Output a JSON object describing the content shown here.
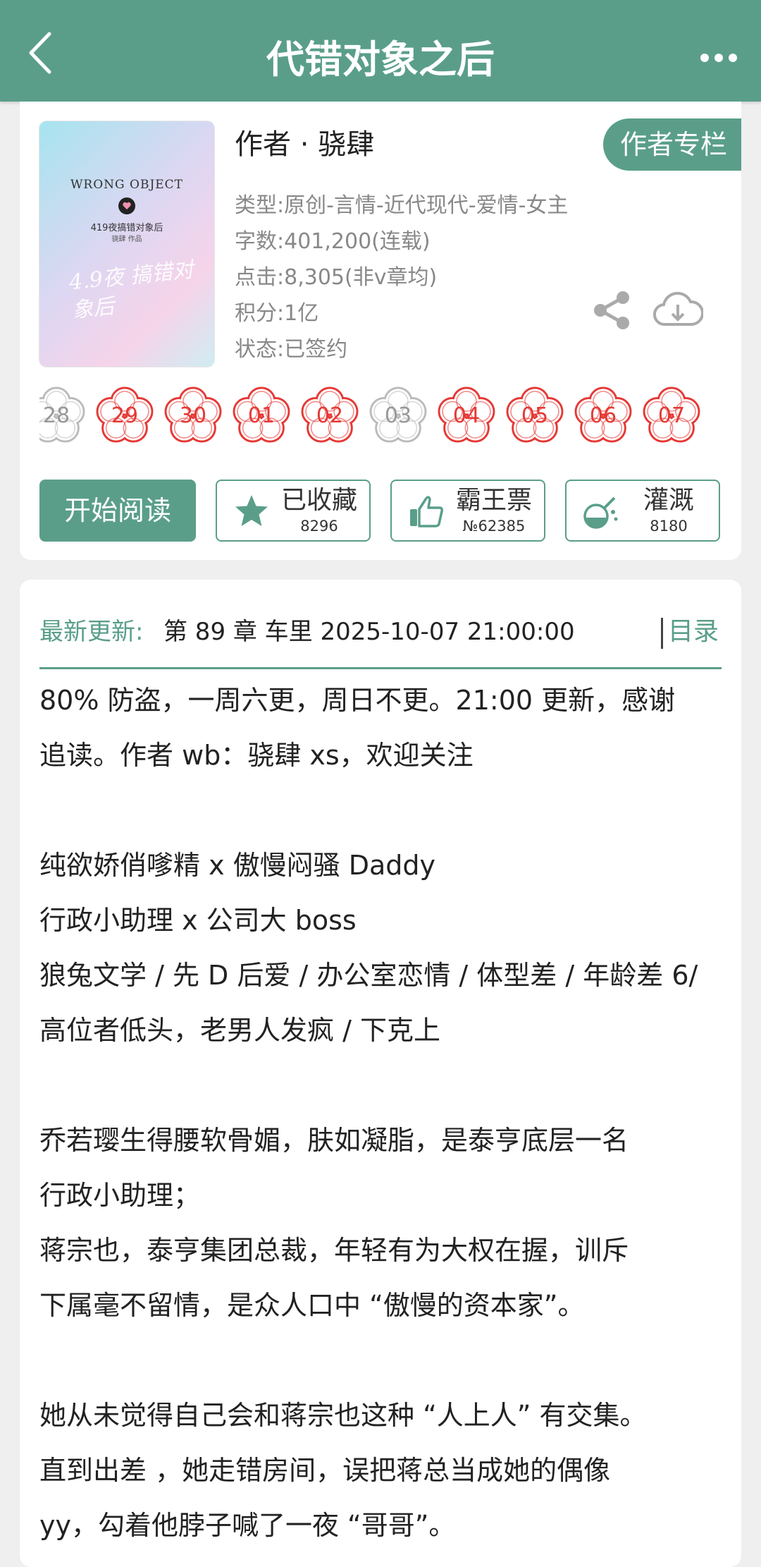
{
  "header": {
    "title": "代错对象之后",
    "back_icon": "chevron-left-icon",
    "more_icon": "more-dots-icon"
  },
  "book": {
    "author": "作者 · 骁肆",
    "author_column_label": "作者专栏",
    "cover": {
      "title_en": "WRONG OBJECT",
      "subtitle": "419夜搞错对象后",
      "author_line": "骁肆 作品",
      "script": "4.9夜 搞错对象后"
    },
    "info": [
      "类型:原创-言情-近代现代-爱情-女主",
      "字数:401,200(连载)",
      "点击:8,305(非v章均)",
      "积分:1亿",
      "状态:已签约"
    ]
  },
  "flowers": [
    {
      "day": "28",
      "active": false
    },
    {
      "day": "29",
      "active": true
    },
    {
      "day": "30",
      "active": true
    },
    {
      "day": "01",
      "active": true
    },
    {
      "day": "02",
      "active": true
    },
    {
      "day": "03",
      "active": false
    },
    {
      "day": "04",
      "active": true
    },
    {
      "day": "05",
      "active": true
    },
    {
      "day": "06",
      "active": true
    },
    {
      "day": "07",
      "active": true
    }
  ],
  "actions": {
    "read_label": "开始阅读",
    "collect": {
      "label": "已收藏",
      "count": "8296"
    },
    "vote": {
      "label": "霸王票",
      "count": "№62385"
    },
    "water": {
      "label": "灌溉",
      "count": "8180"
    }
  },
  "latest": {
    "label": "最新更新:",
    "text": "第 89 章 车里 2025-10-07 21:00:00",
    "catalog_label": "目录"
  },
  "description": [
    "80% 防盗，一周六更，周日不更。21:00 更新，感谢",
    "追读。作者 wb：骁肆 xs，欢迎关注",
    "",
    "纯欲娇俏嗲精 x 傲慢闷骚 Daddy",
    "行政小助理 x 公司大 boss",
    "狼兔文学 / 先 D 后爱 / 办公室恋情 / 体型差 / 年龄差 6/",
    "高位者低头，老男人发疯 / 下克上",
    "",
    "乔若璎生得腰软骨媚，肤如凝脂，是泰亨底层一名",
    "行政小助理；",
    "蒋宗也，泰亨集团总裁，年轻有为大权在握，训斥",
    "下属毫不留情，是众人口中 “傲慢的资本家”。",
    "",
    "她从未觉得自己会和蒋宗也这种 “人上人” 有交集。",
    "直到出差 ，她走错房间，误把蒋总当成她的偶像",
    " yy，勾着他脖子喊了一夜 “哥哥”。"
  ],
  "colors": {
    "accent": "#5a9e8a",
    "flower_active": "#e53935",
    "flower_inactive": "#bbbbbb"
  }
}
